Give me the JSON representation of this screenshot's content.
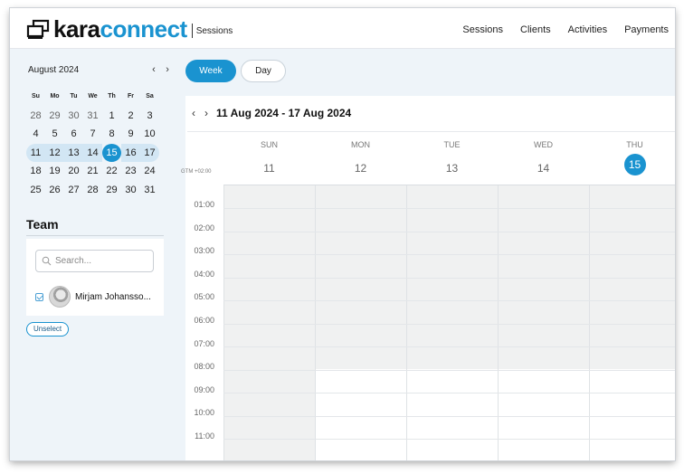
{
  "brand": {
    "name_part1": "kara",
    "name_part2": "connect",
    "section": "Sessions"
  },
  "nav": [
    "Sessions",
    "Clients",
    "Activities",
    "Payments"
  ],
  "mini_calendar": {
    "month_label": "August 2024",
    "prev": "‹",
    "next": "›",
    "weekday_headers": [
      "Su",
      "Mo",
      "Tu",
      "We",
      "Th",
      "Fr",
      "Sa"
    ],
    "weeks": [
      [
        "28",
        "29",
        "30",
        "31",
        "1",
        "2",
        "3"
      ],
      [
        "4",
        "5",
        "6",
        "7",
        "8",
        "9",
        "10"
      ],
      [
        "11",
        "12",
        "13",
        "14",
        "15",
        "16",
        "17"
      ],
      [
        "18",
        "19",
        "20",
        "21",
        "22",
        "23",
        "24"
      ],
      [
        "25",
        "26",
        "27",
        "28",
        "29",
        "30",
        "31"
      ]
    ],
    "today": "15"
  },
  "team": {
    "title": "Team",
    "search_placeholder": "Search...",
    "members": [
      {
        "name": "Mirjam Johansso...",
        "checked": true
      }
    ],
    "unselect_label": "Unselect"
  },
  "view_toggle": {
    "week": "Week",
    "day": "Day",
    "active": "Week"
  },
  "range": {
    "prev": "‹",
    "next": "›",
    "label": "11 Aug 2024 - 17 Aug 2024"
  },
  "timezone": "GTM +02:00",
  "days": [
    {
      "name": "SUN",
      "num": "11"
    },
    {
      "name": "MON",
      "num": "12"
    },
    {
      "name": "TUE",
      "num": "13"
    },
    {
      "name": "WED",
      "num": "14"
    },
    {
      "name": "THU",
      "num": "15",
      "today": true
    }
  ],
  "hours": [
    "01:00",
    "02:00",
    "03:00",
    "04:00",
    "05:00",
    "06:00",
    "07:00",
    "08:00",
    "09:00",
    "10:00",
    "11:00"
  ],
  "colors": {
    "accent": "#1a93d0",
    "sidebar_bg": "#eef4f9",
    "week_band": "#d2e6f4",
    "unavailable": "#f0f1f1"
  }
}
